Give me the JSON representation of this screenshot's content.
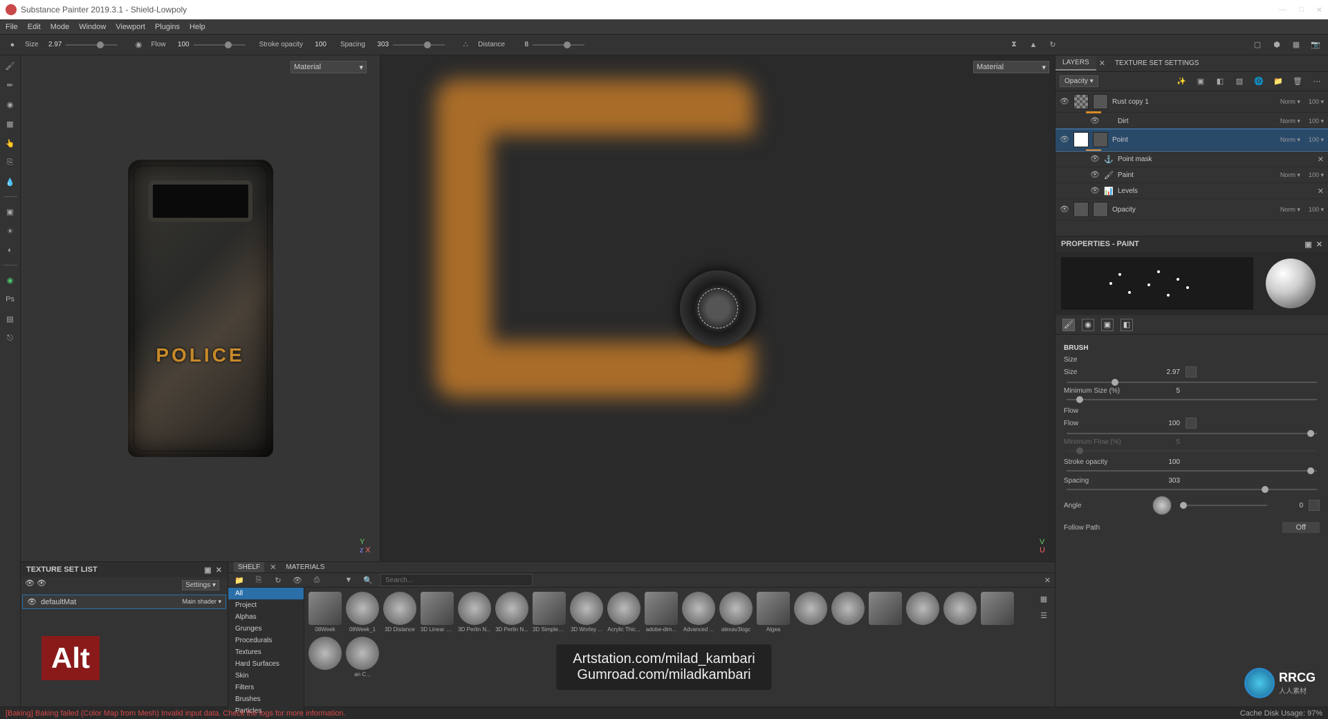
{
  "window": {
    "title": "Substance Painter 2019.3.1 - Shield-Lowpoly",
    "min": "—",
    "max": "□",
    "close": "✕"
  },
  "menu": [
    "File",
    "Edit",
    "Mode",
    "Window",
    "Viewport",
    "Plugins",
    "Help"
  ],
  "toolbar": {
    "size_label": "Size",
    "size_value": "2.97",
    "flow_label": "Flow",
    "flow_value": "100",
    "stroke_label": "Stroke opacity",
    "stroke_value": "100",
    "spacing_label": "Spacing",
    "spacing_value": "303",
    "distance_label": "Distance",
    "distance_value": "8"
  },
  "viewport": {
    "material_dropdown": "Material",
    "police_text": "POLICE",
    "axis3d_y": "Y",
    "axis3d_z": "z",
    "axis3d_x": "X",
    "axis2d_v": "V",
    "axis2d_u": "U"
  },
  "texset": {
    "title": "TEXTURE SET LIST",
    "settings": "Settings ▾",
    "default": "defaultMat",
    "shader": "Main shader ▾"
  },
  "shelf": {
    "tab_shelf": "SHELF",
    "tab_materials": "MATERIALS",
    "search_placeholder": "Search...",
    "categories": [
      "All",
      "Project",
      "Alphas",
      "Grunges",
      "Procedurals",
      "Textures",
      "Hard Surfaces",
      "Skin",
      "Filters",
      "Brushes",
      "Particles"
    ],
    "thumbs": [
      "08Week",
      "08Week_1",
      "3D Distance",
      "3D Linear G...",
      "3D Perlin N...",
      "3D Perlin N...",
      "3D Simplex ...",
      "3D Worley ...",
      "Acrylic Thic...",
      "adobe-dim...",
      "Advanced ...",
      "alexav3logc",
      "Algea",
      "",
      "",
      "",
      "",
      "",
      "",
      "",
      "an C..."
    ],
    "close": "✕"
  },
  "right": {
    "tab_layers": "LAYERS",
    "tab_texset": "TEXTURE SET SETTINGS",
    "opacity_drop": "Opacity ▾",
    "layers": [
      {
        "name": "Rust copy 1",
        "blend": "Norm ▾",
        "opac": "100 ▾"
      },
      {
        "name": "Dirt",
        "blend": "Norm ▾",
        "opac": "100 ▾",
        "sub": true
      },
      {
        "name": "Point",
        "blend": "Norm ▾",
        "opac": "100 ▾",
        "sel": true
      },
      {
        "name": "Point mask",
        "sub": true
      },
      {
        "name": "Paint",
        "blend": "Norm ▾",
        "opac": "100 ▾",
        "sub": true
      },
      {
        "name": "Levels",
        "sub": true
      },
      {
        "name": "Opacity",
        "blend": "Norm ▾",
        "opac": "100 ▾"
      }
    ],
    "props_title": "PROPERTIES - PAINT",
    "brush_title": "BRUSH",
    "brush": {
      "size_lbl": "Size",
      "size_lbl2": "Size",
      "size_val": "2.97",
      "minsize_lbl": "Minimum Size (%)",
      "minsize_val": "5",
      "flow_section": "Flow",
      "flow_lbl": "Flow",
      "flow_val": "100",
      "minflow_lbl": "Minimum Flow (%)",
      "minflow_val": "5",
      "stroke_lbl": "Stroke opacity",
      "stroke_val": "100",
      "spacing_lbl": "Spacing",
      "spacing_val": "303",
      "angle_lbl": "Angle",
      "angle_val": "0",
      "follow_lbl": "Follow Path",
      "follow_val": "Off"
    }
  },
  "status": {
    "error": "[Baking] Baking failed (Color Map from Mesh) Invalid input data. Check the logs for more information.",
    "cache": "Cache Disk Usage:   97%"
  },
  "overlay": {
    "alt": "Alt",
    "credit1": "Artstation.com/milad_kambari",
    "credit2": "Gumroad.com/miladkambari",
    "rrcg": "RRCG",
    "rrcg_sub": "人人素材"
  }
}
